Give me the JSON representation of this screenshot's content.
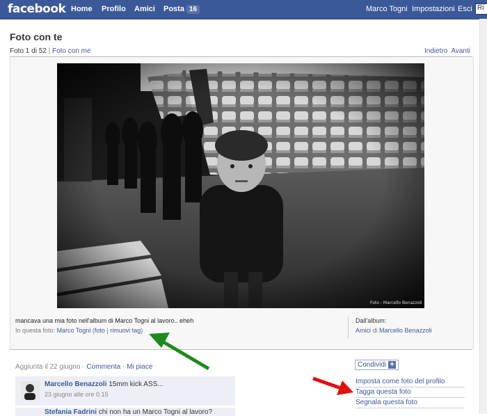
{
  "topbar": {
    "logo": "facebook",
    "nav": {
      "home": "Home",
      "profile": "Profilo",
      "friends": "Amici",
      "posts": "Posta",
      "posts_count": "16"
    },
    "right": {
      "user": "Marco Togni",
      "settings": "Impostazioni",
      "logout": "Esci"
    },
    "search_value": "Ri"
  },
  "header": {
    "title": "Foto con te",
    "count_text": "Foto 1 di 52",
    "sep": "|",
    "with_me_link": "Foto con me",
    "back": "Indietro",
    "next": "Avanti"
  },
  "photo": {
    "credit": "Foto - Marcello Benazzoli"
  },
  "caption": {
    "text": "mancava una mia foto nell'album di Marco Togni al lavoro.. eheh",
    "in_photo_label": "In questa foto:",
    "tagged_name": "Marco Togni",
    "photo_link": "foto",
    "remove_tag": "rimuovi tag"
  },
  "album": {
    "label": "Dall'album:",
    "album_name": "Amici",
    "of": "di",
    "owner": "Marcello Benazzoli"
  },
  "meta": {
    "added": "Aggiunta il 22 giugno",
    "dot": "·",
    "comment_link": "Commenta",
    "like_link": "Mi piace"
  },
  "comments": [
    {
      "author": "Marcello Benazzoli",
      "text": "15mm kick ASS...",
      "time": "23 giugno alle ore 0.15"
    },
    {
      "author": "Stefania Fadrini",
      "text": "chi non ha un Marco Togni al lavoro?"
    }
  ],
  "actions": {
    "share": "Condividi",
    "share_plus": "+",
    "set_profile": "Imposta come foto del profilo",
    "tag": "Tagga questa foto",
    "report": "Segnala questa foto"
  },
  "colors": {
    "brand": "#3b5998",
    "arrow_green": "#1e8a1e",
    "arrow_red": "#e01010"
  }
}
